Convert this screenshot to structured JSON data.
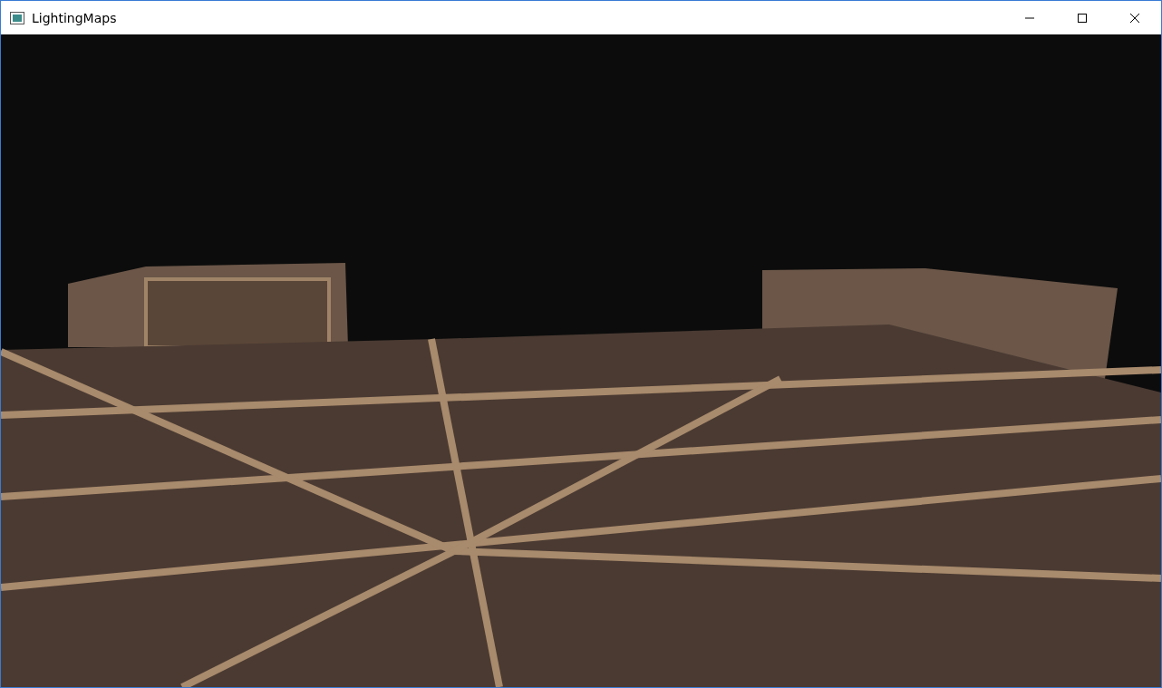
{
  "window": {
    "title": "LightingMaps"
  }
}
